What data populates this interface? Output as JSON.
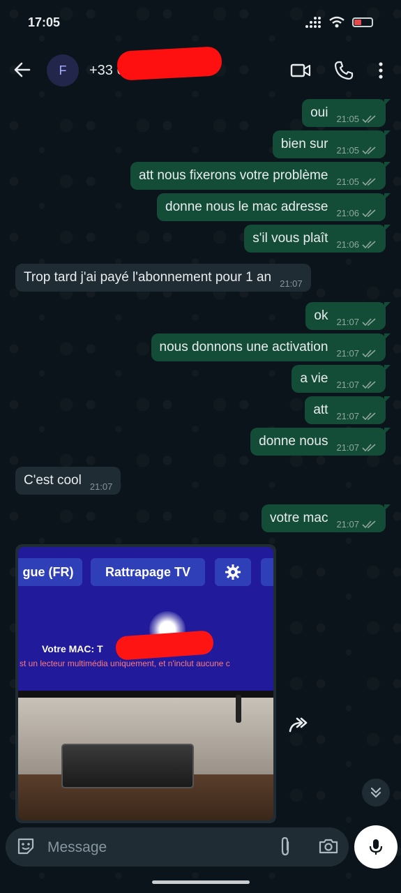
{
  "status_bar": {
    "time": "17:05",
    "battery_color": "#e34a4a"
  },
  "header": {
    "avatar_letter": "F",
    "contact_name": "+33 6"
  },
  "messages": [
    {
      "text": "oui",
      "time": "21:05"
    },
    {
      "text": "bien sur",
      "time": "21:05"
    },
    {
      "text": "att nous fixerons votre problème",
      "time": "21:05"
    },
    {
      "text": "donne nous le mac adresse",
      "time": "21:06"
    },
    {
      "text": "s'il vous plaît",
      "time": "21:06"
    },
    {
      "text": "Trop tard j'ai payé l'abonnement pour 1 an",
      "time": "21:07"
    },
    {
      "text": "ok",
      "time": "21:07"
    },
    {
      "text": "nous donnons une activation",
      "time": "21:07"
    },
    {
      "text": "a vie",
      "time": "21:07"
    },
    {
      "text": "att",
      "time": "21:07"
    },
    {
      "text": "donne nous",
      "time": "21:07"
    },
    {
      "text": "C'est cool",
      "time": "21:07"
    },
    {
      "text": "votre mac",
      "time": "21:07"
    }
  ],
  "image_message": {
    "tab_language": "gue (FR)",
    "tab_replay": "Rattrapage TV",
    "mac_label": "Votre MAC: T",
    "notice": "st un lecteur multimédia uniquement, et n'inclut aucune c"
  },
  "input": {
    "placeholder": "Message"
  },
  "colors": {
    "outgoing": "#144d37",
    "incoming": "#202c33",
    "background": "#0b141a",
    "ticks": "#8fa7a0"
  },
  "icons": [
    "back-arrow-icon",
    "video-call-icon",
    "phone-icon",
    "more-options-icon",
    "sticker-icon",
    "attach-icon",
    "camera-icon",
    "mic-icon",
    "forward-icon",
    "scroll-down-icon"
  ]
}
